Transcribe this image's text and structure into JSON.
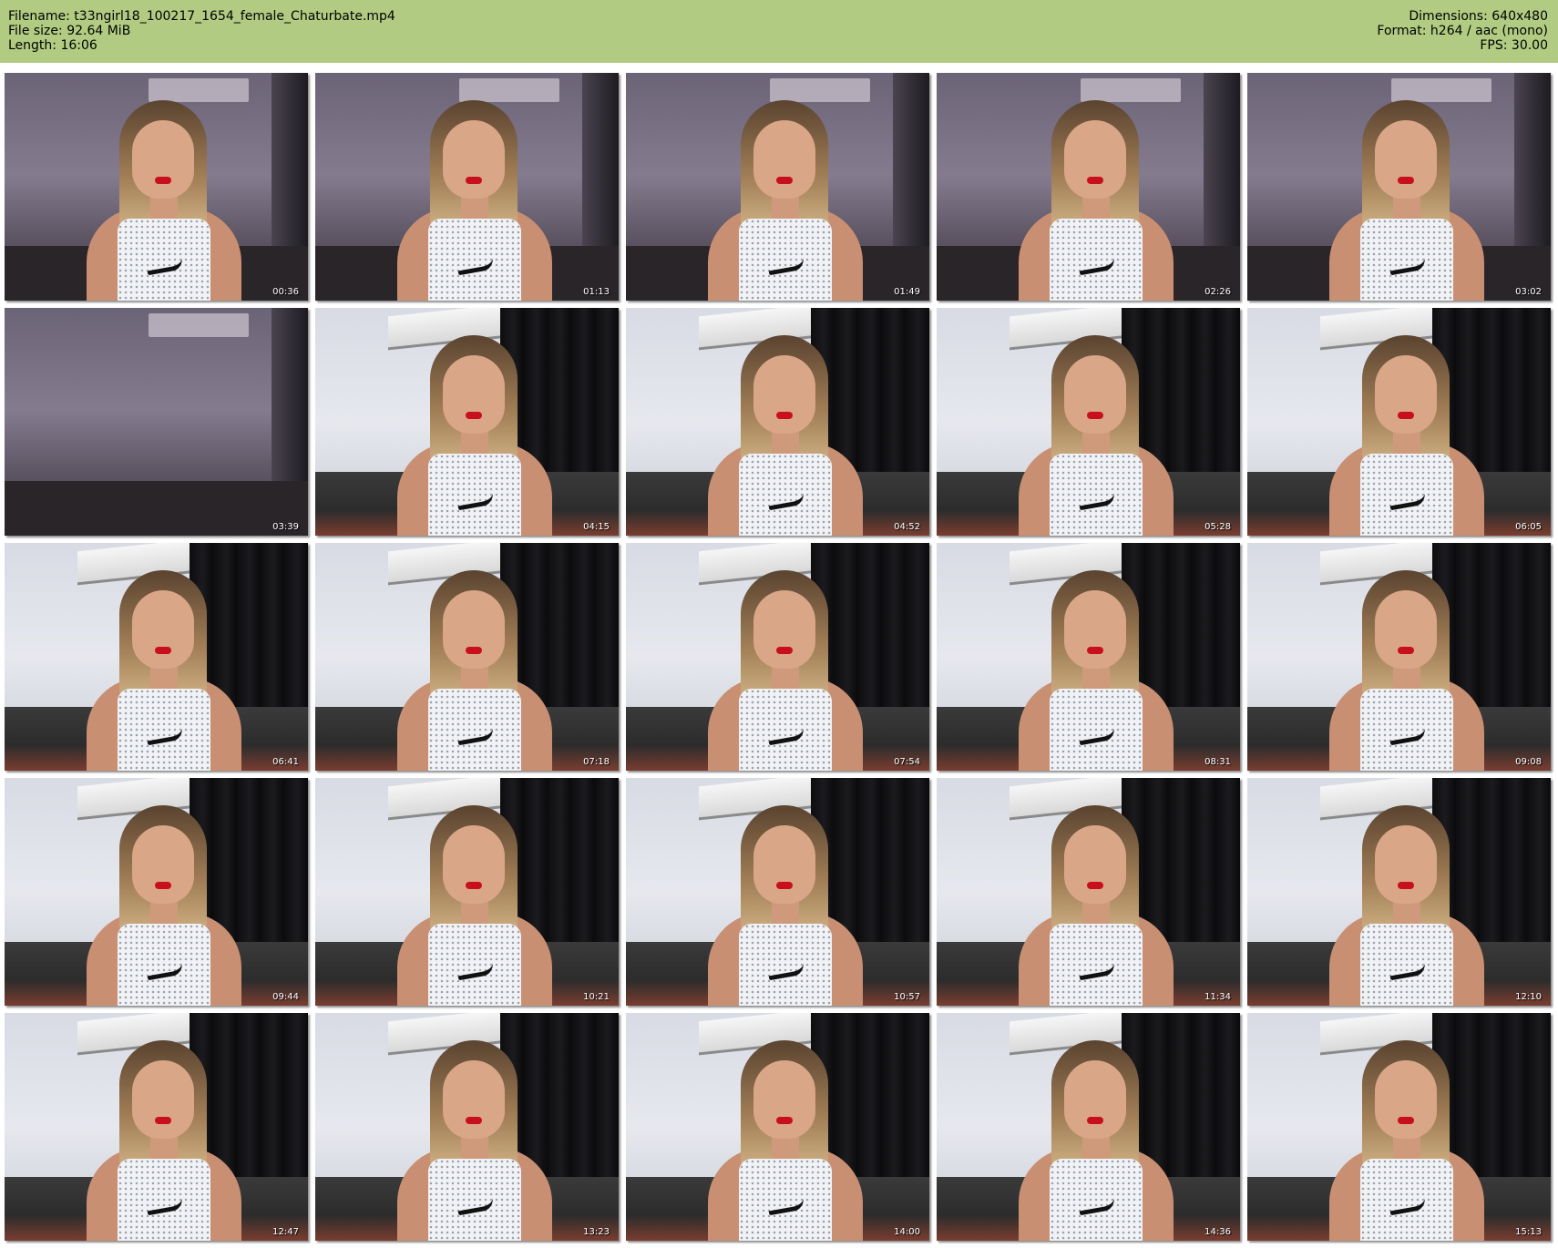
{
  "header": {
    "filename": "Filename: t33ngirl18_100217_1654_female_Chaturbate.mp4",
    "file_size": "File size: 92.64 MiB",
    "length": "Length: 16:06",
    "dimensions": "Dimensions: 640x480",
    "format": "Format: h264 / aac (mono)",
    "fps": "FPS: 30.00"
  },
  "colors": {
    "header_background": "#b1cc82",
    "page_background": "#ffffff"
  },
  "thumbnails": [
    {
      "timestamp": "00:36",
      "scene": "dim-room"
    },
    {
      "timestamp": "01:13",
      "scene": "dim-room"
    },
    {
      "timestamp": "01:49",
      "scene": "dim-room"
    },
    {
      "timestamp": "02:26",
      "scene": "dim-room"
    },
    {
      "timestamp": "03:02",
      "scene": "dim-room"
    },
    {
      "timestamp": "03:39",
      "scene": "dim-room-empty"
    },
    {
      "timestamp": "04:15",
      "scene": "bright-room"
    },
    {
      "timestamp": "04:52",
      "scene": "bright-room"
    },
    {
      "timestamp": "05:28",
      "scene": "bright-room"
    },
    {
      "timestamp": "06:05",
      "scene": "bright-room"
    },
    {
      "timestamp": "06:41",
      "scene": "bright-room"
    },
    {
      "timestamp": "07:18",
      "scene": "bright-room"
    },
    {
      "timestamp": "07:54",
      "scene": "bright-room"
    },
    {
      "timestamp": "08:31",
      "scene": "bright-room"
    },
    {
      "timestamp": "09:08",
      "scene": "bright-room"
    },
    {
      "timestamp": "09:44",
      "scene": "bright-room"
    },
    {
      "timestamp": "10:21",
      "scene": "bright-room"
    },
    {
      "timestamp": "10:57",
      "scene": "bright-room"
    },
    {
      "timestamp": "11:34",
      "scene": "bright-room"
    },
    {
      "timestamp": "12:10",
      "scene": "bright-room"
    },
    {
      "timestamp": "12:47",
      "scene": "bright-room"
    },
    {
      "timestamp": "13:23",
      "scene": "bright-room"
    },
    {
      "timestamp": "14:00",
      "scene": "bright-room"
    },
    {
      "timestamp": "14:36",
      "scene": "bright-room"
    },
    {
      "timestamp": "15:13",
      "scene": "bright-room"
    }
  ]
}
